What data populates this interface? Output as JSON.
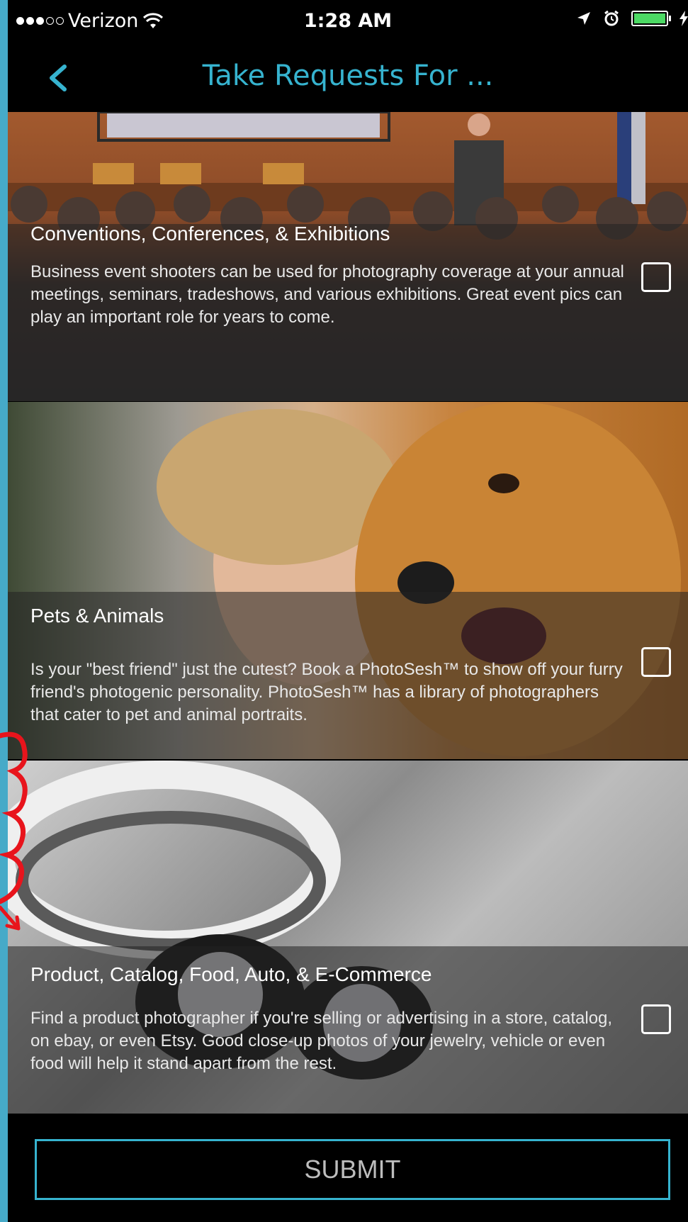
{
  "status_bar": {
    "carrier": "Verizon",
    "time": "1:28 AM"
  },
  "nav": {
    "title": "Take Requests For ..."
  },
  "cards": [
    {
      "title": "Conventions, Conferences, & Exhibitions",
      "description": "Business event shooters can be used for photography coverage at your annual meetings, seminars, tradeshows, and various exhibitions.  Great event pics can play an important role for years to come.",
      "checked": false
    },
    {
      "title": "Pets & Animals",
      "description": "Is your \"best friend\" just the cutest?  Book a PhotoSesh™ to show off your furry friend's photogenic personality.  PhotoSesh™ has a library of photographers that cater to pet and animal portraits.",
      "checked": false
    },
    {
      "title": "Product, Catalog, Food, Auto, & E-Commerce",
      "description": "Find a product photographer if you're selling or advertising in a store, catalog, on ebay, or even Etsy.  Good close-up photos of your jewelry, vehicle or even food will help it stand apart from the rest.",
      "checked": false
    }
  ],
  "submit_label": "SUBMIT",
  "colors": {
    "accent": "#36b3cf",
    "frame": "#46aac8",
    "annotation": "#e8141c"
  }
}
